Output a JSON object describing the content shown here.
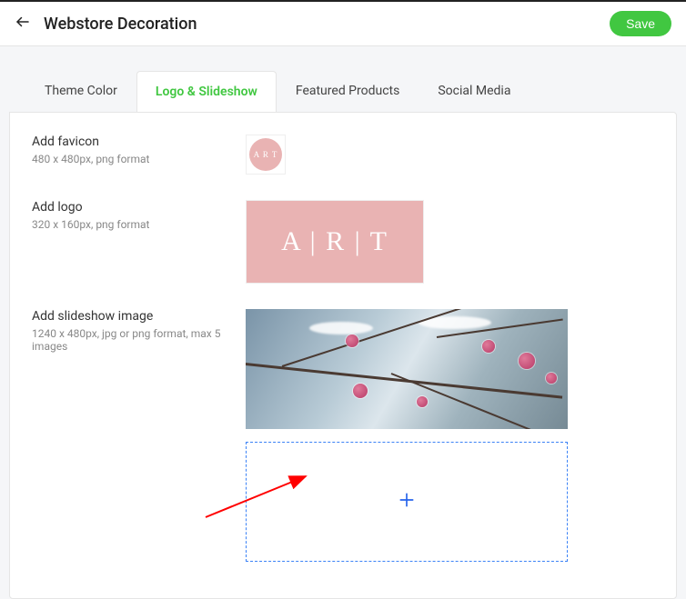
{
  "header": {
    "title": "Webstore Decoration",
    "save_label": "Save"
  },
  "tabs": [
    {
      "label": "Theme Color",
      "active": false
    },
    {
      "label": "Logo & Slideshow",
      "active": true
    },
    {
      "label": "Featured Products",
      "active": false
    },
    {
      "label": "Social Media",
      "active": false
    }
  ],
  "fields": {
    "favicon": {
      "title": "Add favicon",
      "hint": "480 x 480px, png format",
      "thumb_text": "A R T"
    },
    "logo": {
      "title": "Add logo",
      "hint": "320 x 160px, png format",
      "thumb_text": "A | R | T"
    },
    "slideshow": {
      "title": "Add slideshow image",
      "hint": "1240 x 480px, jpg or png format, max 5 images"
    }
  }
}
